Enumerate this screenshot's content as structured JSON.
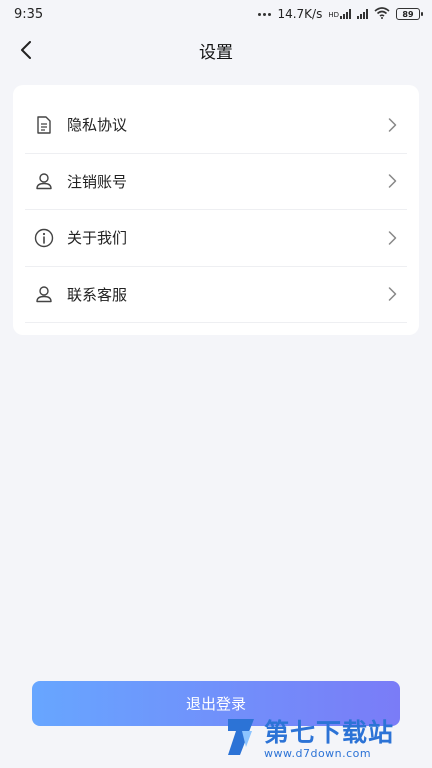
{
  "status_bar": {
    "time": "9:35",
    "network_speed": "14.7K/s",
    "hd_label": "HD",
    "battery": "89"
  },
  "header": {
    "title": "设置"
  },
  "menu": {
    "items": [
      {
        "label": "隐私协议",
        "icon": "document-icon"
      },
      {
        "label": "注销账号",
        "icon": "user-icon"
      },
      {
        "label": "关于我们",
        "icon": "info-icon"
      },
      {
        "label": "联系客服",
        "icon": "user-icon"
      }
    ]
  },
  "logout": {
    "label": "退出登录"
  },
  "watermark": {
    "title": "第七下载站",
    "url": "www.d7down.com"
  },
  "colors": {
    "background": "#f4f5f9",
    "gradient_start": "#67a6ff",
    "gradient_end": "#7a7cf7",
    "watermark": "#2c73d6"
  }
}
